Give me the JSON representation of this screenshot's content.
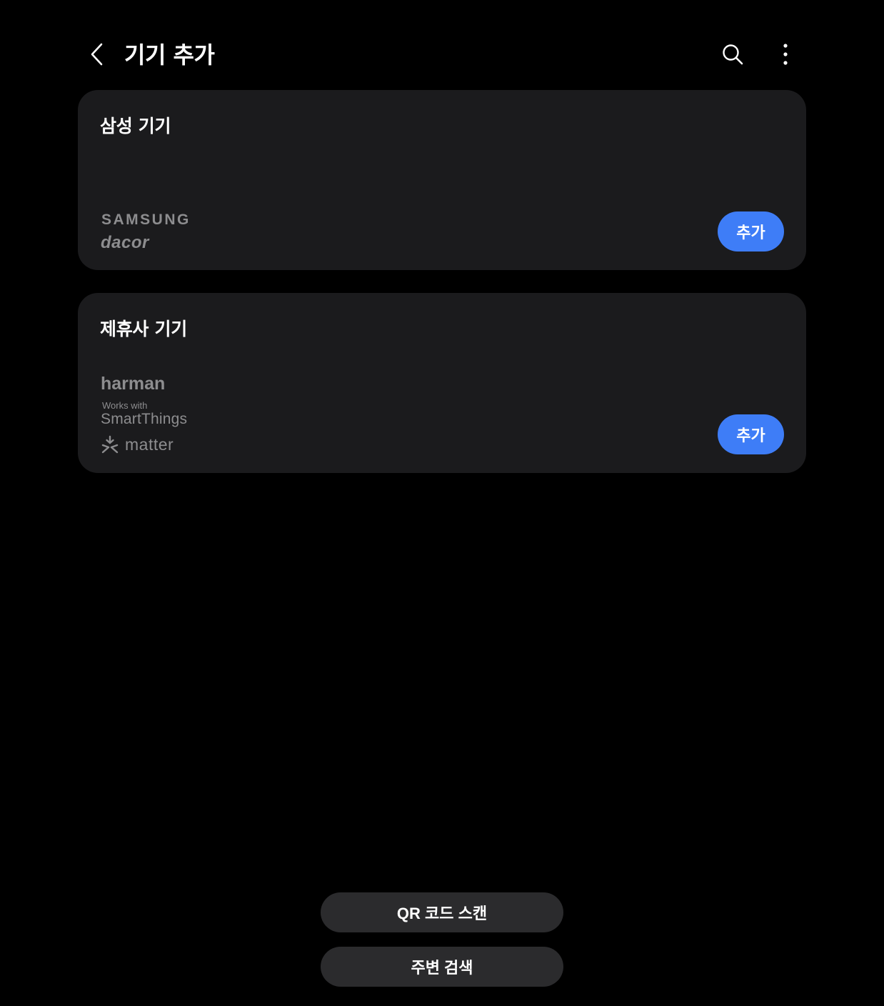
{
  "header": {
    "title": "기기 추가",
    "back_icon": "chevron-left-icon",
    "search_icon": "search-icon",
    "more_icon": "more-vertical-icon"
  },
  "sections": {
    "samsung": {
      "title": "삼성 기기",
      "brands": {
        "samsung": "SAMSUNG",
        "dacor": "dacor"
      },
      "add_label": "추가"
    },
    "partner": {
      "title": "제휴사 기기",
      "brands": {
        "harman": "harman",
        "works_with": "Works with",
        "smartthings": "SmartThings",
        "matter": "matter"
      },
      "add_label": "추가"
    }
  },
  "bottom_actions": {
    "qr_scan": "QR 코드 스캔",
    "nearby_search": "주변 검색"
  },
  "colors": {
    "background": "#000000",
    "card": "#1b1b1d",
    "accent": "#3e7df7",
    "secondary_button": "#2b2b2d",
    "logo_gray": "#8d8d8f"
  }
}
